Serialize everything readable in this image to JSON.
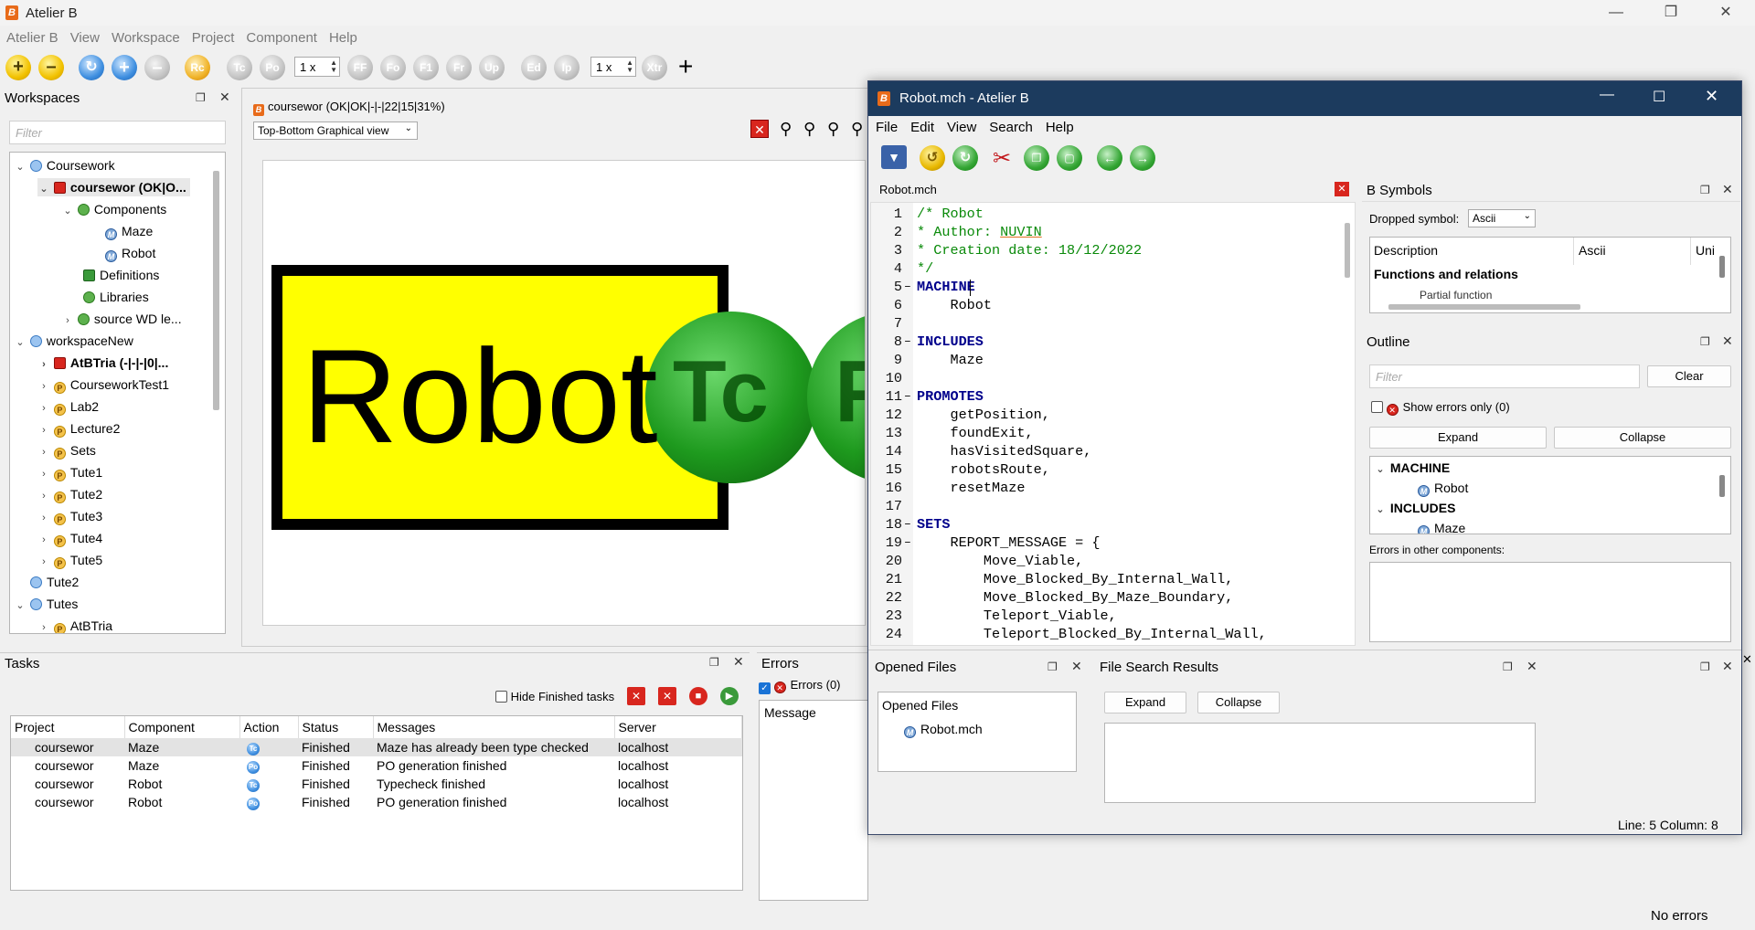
{
  "app": {
    "title": "Atelier B"
  },
  "menubar": [
    "Atelier B",
    "View",
    "Workspace",
    "Project",
    "Component",
    "Help"
  ],
  "toolbar": {
    "zoom1": "1 x",
    "zoom2": "1 x",
    "buttons": [
      "Tc",
      "Po",
      "FF",
      "Fo",
      "F1",
      "Fr",
      "Up",
      "Ed",
      "Ip",
      "Xtr"
    ]
  },
  "workspaces": {
    "title": "Workspaces",
    "filter_placeholder": "Filter",
    "tree": [
      {
        "label": "Coursework"
      },
      {
        "label": "coursewor (OK|O..."
      },
      {
        "label": "Components"
      },
      {
        "label": "Maze"
      },
      {
        "label": "Robot"
      },
      {
        "label": "Definitions"
      },
      {
        "label": "Libraries"
      },
      {
        "label": "source WD le..."
      },
      {
        "label": "workspaceNew"
      },
      {
        "label": "AtBTria (-|-|-|0|..."
      },
      {
        "label": "CourseworkTest1"
      },
      {
        "label": "Lab2"
      },
      {
        "label": "Lecture2"
      },
      {
        "label": "Sets"
      },
      {
        "label": "Tute1"
      },
      {
        "label": "Tute2"
      },
      {
        "label": "Tute3"
      },
      {
        "label": "Tute4"
      },
      {
        "label": "Tute5"
      },
      {
        "label": "Tute2"
      },
      {
        "label": "Tutes"
      },
      {
        "label": "AtBTria"
      }
    ]
  },
  "graph": {
    "tab_title": "coursewor (OK|OK|-|-|22|15|31%)",
    "view_select": "Top-Bottom Graphical view",
    "node_label": "Robot",
    "badge1": "Tc",
    "badge2": "P"
  },
  "tasks": {
    "title": "Tasks",
    "hide_finished_label": "Hide Finished tasks",
    "columns": [
      "Project",
      "Component",
      "Action",
      "Status",
      "Messages",
      "Server"
    ],
    "rows": [
      {
        "project": "coursewor",
        "component": "Maze",
        "action": "Tc",
        "status": "Finished",
        "message": "Maze has already been type checked",
        "server": "localhost"
      },
      {
        "project": "coursewor",
        "component": "Maze",
        "action": "Po",
        "status": "Finished",
        "message": "PO generation finished",
        "server": "localhost"
      },
      {
        "project": "coursewor",
        "component": "Robot",
        "action": "Tc",
        "status": "Finished",
        "message": "Typecheck finished",
        "server": "localhost"
      },
      {
        "project": "coursewor",
        "component": "Robot",
        "action": "Po",
        "status": "Finished",
        "message": "PO generation finished",
        "server": "localhost"
      }
    ]
  },
  "errors": {
    "title": "Errors",
    "errors_filter": "Errors (0)",
    "column": "Message"
  },
  "statusbar": {
    "text": "No errors"
  },
  "editor": {
    "title": "Robot.mch - Atelier B",
    "menu": [
      "File",
      "Edit",
      "View",
      "Search",
      "Help"
    ],
    "tab": "Robot.mch",
    "lines": [
      "/* Robot",
      "* Author: NUVIN",
      "* Creation date: 18/12/2022",
      "*/",
      "MACHINE",
      "    Robot",
      "",
      "INCLUDES",
      "    Maze",
      "",
      "PROMOTES",
      "    getPosition,",
      "    foundExit,",
      "    hasVisitedSquare,",
      "    robotsRoute,",
      "    resetMaze",
      "",
      "SETS",
      "    REPORT_MESSAGE = {",
      "        Move_Viable,",
      "        Move_Blocked_By_Internal_Wall,",
      "        Move_Blocked_By_Maze_Boundary,",
      "        Teleport_Viable,",
      "        Teleport_Blocked_By_Internal_Wall,"
    ],
    "status": "Line: 5 Column: 8",
    "bsymbols": {
      "title": "B Symbols",
      "dropped_label": "Dropped symbol:",
      "dropped_value": "Ascii",
      "columns": [
        "Description",
        "Ascii",
        "Uni"
      ],
      "group": "Functions and relations",
      "row_partial": "Partial function"
    },
    "outline": {
      "title": "Outline",
      "filter_placeholder": "Filter",
      "clear": "Clear",
      "show_errors": "Show errors only (0)",
      "expand": "Expand",
      "collapse": "Collapse",
      "tree": [
        "MACHINE",
        "Robot",
        "INCLUDES",
        "Maze"
      ],
      "errors_other": "Errors in other components:"
    },
    "opened_files": {
      "title": "Opened Files",
      "header": "Opened Files",
      "file": "Robot.mch"
    },
    "file_search": {
      "title": "File Search Results",
      "expand": "Expand",
      "collapse": "Collapse"
    }
  }
}
